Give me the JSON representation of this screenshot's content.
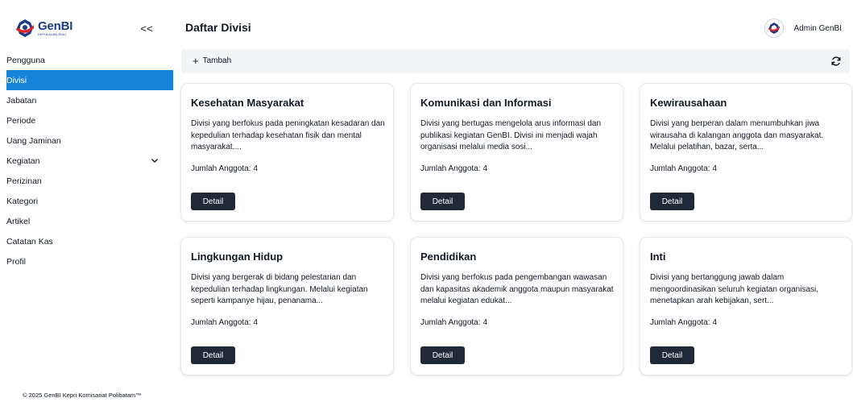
{
  "brand": {
    "name": "GenBI",
    "subtitle": "KEPULAUAN RIAU",
    "color": "#1e3a8a"
  },
  "sidebar": {
    "collapse_label": "<<",
    "items": [
      {
        "label": "Pengguna"
      },
      {
        "label": "Divisi",
        "active": true
      },
      {
        "label": "Jabatan"
      },
      {
        "label": "Periode"
      },
      {
        "label": "Uang Jaminan"
      },
      {
        "label": "Kegiatan",
        "icon": "chevron-down-icon"
      },
      {
        "label": "Perizinan"
      },
      {
        "label": "Kategori"
      },
      {
        "label": "Artikel"
      },
      {
        "label": "Catatan Kas"
      },
      {
        "label": "Profil"
      }
    ],
    "active_color": "#1683db",
    "footer": "© 2025 GenBI Kepri Komisariat Polibatam™"
  },
  "header": {
    "title": "Daftar Divisi",
    "user_name": "Admin GenBI",
    "avatar_icon": "genbi-logo-icon"
  },
  "toolbar": {
    "add_label": "Tambah",
    "add_icon": "plus-icon",
    "refresh_icon": "refresh-icon"
  },
  "count_label": "Jumlah Anggota:",
  "detail_label": "Detail",
  "divisions": [
    {
      "title": "Kesehatan Masyarakat",
      "description": "Divisi yang berfokus pada peningkatan kesadaran dan kepedulian terhadap kesehatan fisik dan mental masyarakat....",
      "members": "4"
    },
    {
      "title": "Komunikasi dan Informasi",
      "description": "Divisi yang bertugas mengelola arus informasi dan publikasi kegiatan GenBI. Divisi ini menjadi wajah organisasi melalui media sosi...",
      "members": "4"
    },
    {
      "title": "Kewirausahaan",
      "description": "Divisi yang berperan dalam menumbuhkan jiwa wirausaha di kalangan anggota dan masyarakat. Melalui pelatihan, bazar, serta...",
      "members": "4"
    },
    {
      "title": "Lingkungan Hidup",
      "description": "Divisi yang bergerak di bidang pelestarian dan kepedulian terhadap lingkungan. Melalui kegiatan seperti kampanye hijau, penanama...",
      "members": "4"
    },
    {
      "title": "Pendidikan",
      "description": "Divisi yang berfokus pada pengembangan wawasan dan kapasitas akademik anggota maupun masyarakat melalui kegiatan edukat...",
      "members": "4"
    },
    {
      "title": "Inti",
      "description": "Divisi yang bertanggung jawab dalam mengoordinasikan seluruh kegiatan organisasi, menetapkan arah kebijakan, sert...",
      "members": "4"
    }
  ]
}
